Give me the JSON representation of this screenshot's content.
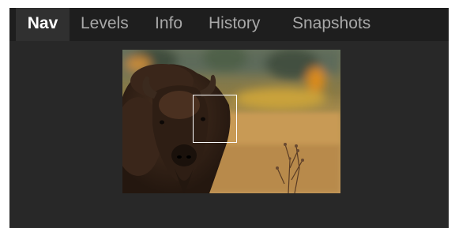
{
  "tabs": [
    {
      "label": "Nav",
      "active": true
    },
    {
      "label": "Levels",
      "active": false
    },
    {
      "label": "Info",
      "active": false
    },
    {
      "label": "History",
      "active": false
    },
    {
      "label": "Snapshots",
      "active": false
    }
  ],
  "colors": {
    "panel_background": "#282828",
    "tabbar_background": "#1e1e1e",
    "active_tab_background": "#303030",
    "active_tab_text": "#ffffff",
    "inactive_tab_text": "#a8a8a8",
    "viewport_frame": "#ffffff"
  },
  "navigator": {
    "subject": "bison in a golden meadow",
    "viewport_indicator": "zoom-rectangle"
  }
}
